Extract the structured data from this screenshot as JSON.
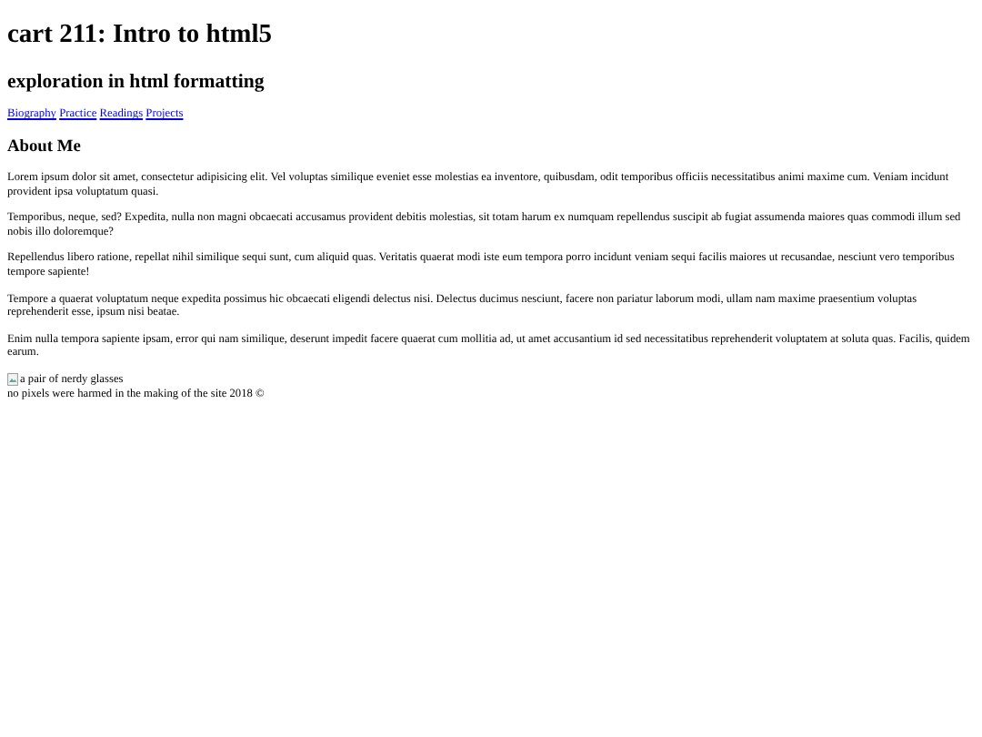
{
  "title": "cart 211: Intro to html5",
  "subtitle": "exploration in html formatting",
  "nav": [
    "Biography",
    "Practice",
    "Readings",
    "Projects"
  ],
  "section_heading": "About Me",
  "paragraphs": [
    "Lorem ipsum dolor sit amet, consectetur adipisicing elit. Vel voluptas similique eveniet esse molestias ea inventore, quibusdam, odit temporibus officiis necessitatibus animi maxime cum. Veniam incidunt provident ipsa voluptatum quasi.",
    "Temporibus, neque, sed? Expedita, nulla non magni obcaecati accusamus provident debitis molestias, sit totam harum ex numquam repellendus suscipit ab fugiat assumenda maiores quas commodi illum sed nobis illo doloremque?",
    "Repellendus libero ratione, repellat nihil similique sequi sunt, cum aliquid quas. Veritatis quaerat modi iste eum tempora porro incidunt veniam sequi facilis maiores ut recusandae, nesciunt vero temporibus tempore sapiente!",
    "Tempore a quaerat voluptatum neque expedita possimus hic obcaecati eligendi delectus nisi. Delectus ducimus nesciunt, facere non pariatur laborum modi, ullam nam maxime praesentium voluptas reprehenderit esse, ipsum nisi beatae.",
    "Enim nulla tempora sapiente ipsam, error qui nam similique, deserunt impedit facere quaerat cum mollitia ad, ut amet accusantium id sed necessitatibus reprehenderit voluptatem at soluta quas. Facilis, quidem earum."
  ],
  "image": {
    "kind": "broken",
    "alt": "a pair of nerdy glasses"
  },
  "footer": "no pixels were harmed in the making of the site 2018 ©"
}
